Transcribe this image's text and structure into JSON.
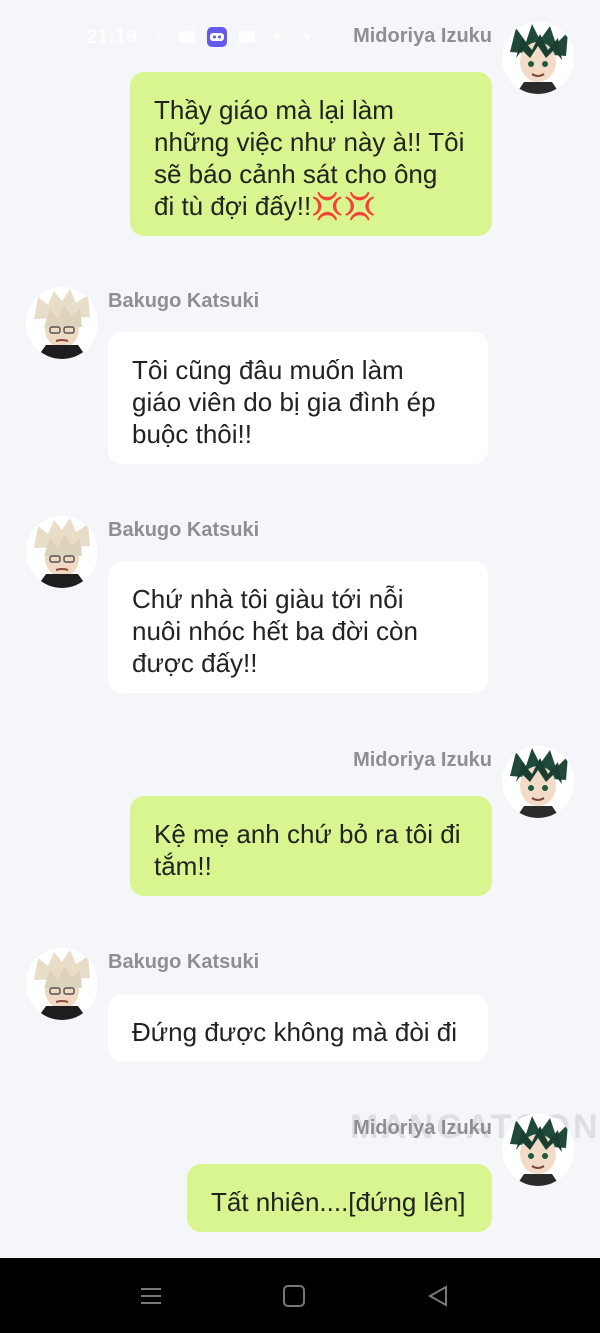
{
  "status_bar": {
    "time": "21:19",
    "icons": [
      "tiktok-icon",
      "image-icon",
      "discord-icon",
      "gallery-icon",
      "notification-icon",
      "signal-icon"
    ]
  },
  "messages": [
    {
      "side": "right",
      "sender": "Midoriya Izuku",
      "text": "Thầy giáo mà lại làm\nnhững việc như này à!! Tôi\nsẽ báo cảnh sát cho ông\nđi tù đợi đấy!!💢💢"
    },
    {
      "side": "left",
      "sender": "Bakugo Katsuki",
      "text": "Tôi cũng đâu muốn làm\ngiáo viên do bị gia đình ép\nbuộc thôi!!"
    },
    {
      "side": "left",
      "sender": "Bakugo Katsuki",
      "text": "Chứ nhà tôi giàu tới nỗi\nnuôi nhóc hết ba đời còn\nđược đấy!!"
    },
    {
      "side": "right",
      "sender": "Midoriya Izuku",
      "text": "Kệ mẹ anh chứ bỏ ra tôi đi\ntắm!!"
    },
    {
      "side": "left",
      "sender": "Bakugo Katsuki",
      "text": "Đứng được không mà đòi đi"
    },
    {
      "side": "right",
      "sender": "Midoriya Izuku",
      "text": "Tất nhiên....[đứng lên]"
    }
  ],
  "watermark": "MANGATOON",
  "colors": {
    "background": "#f4f6f9",
    "right_bubble": "#d9f58f",
    "left_bubble": "#ffffff",
    "name_text": "#8e8e93",
    "nav_bar": "#000000"
  },
  "nav": {
    "icons": [
      "recent-apps-icon",
      "home-icon",
      "back-icon"
    ]
  }
}
